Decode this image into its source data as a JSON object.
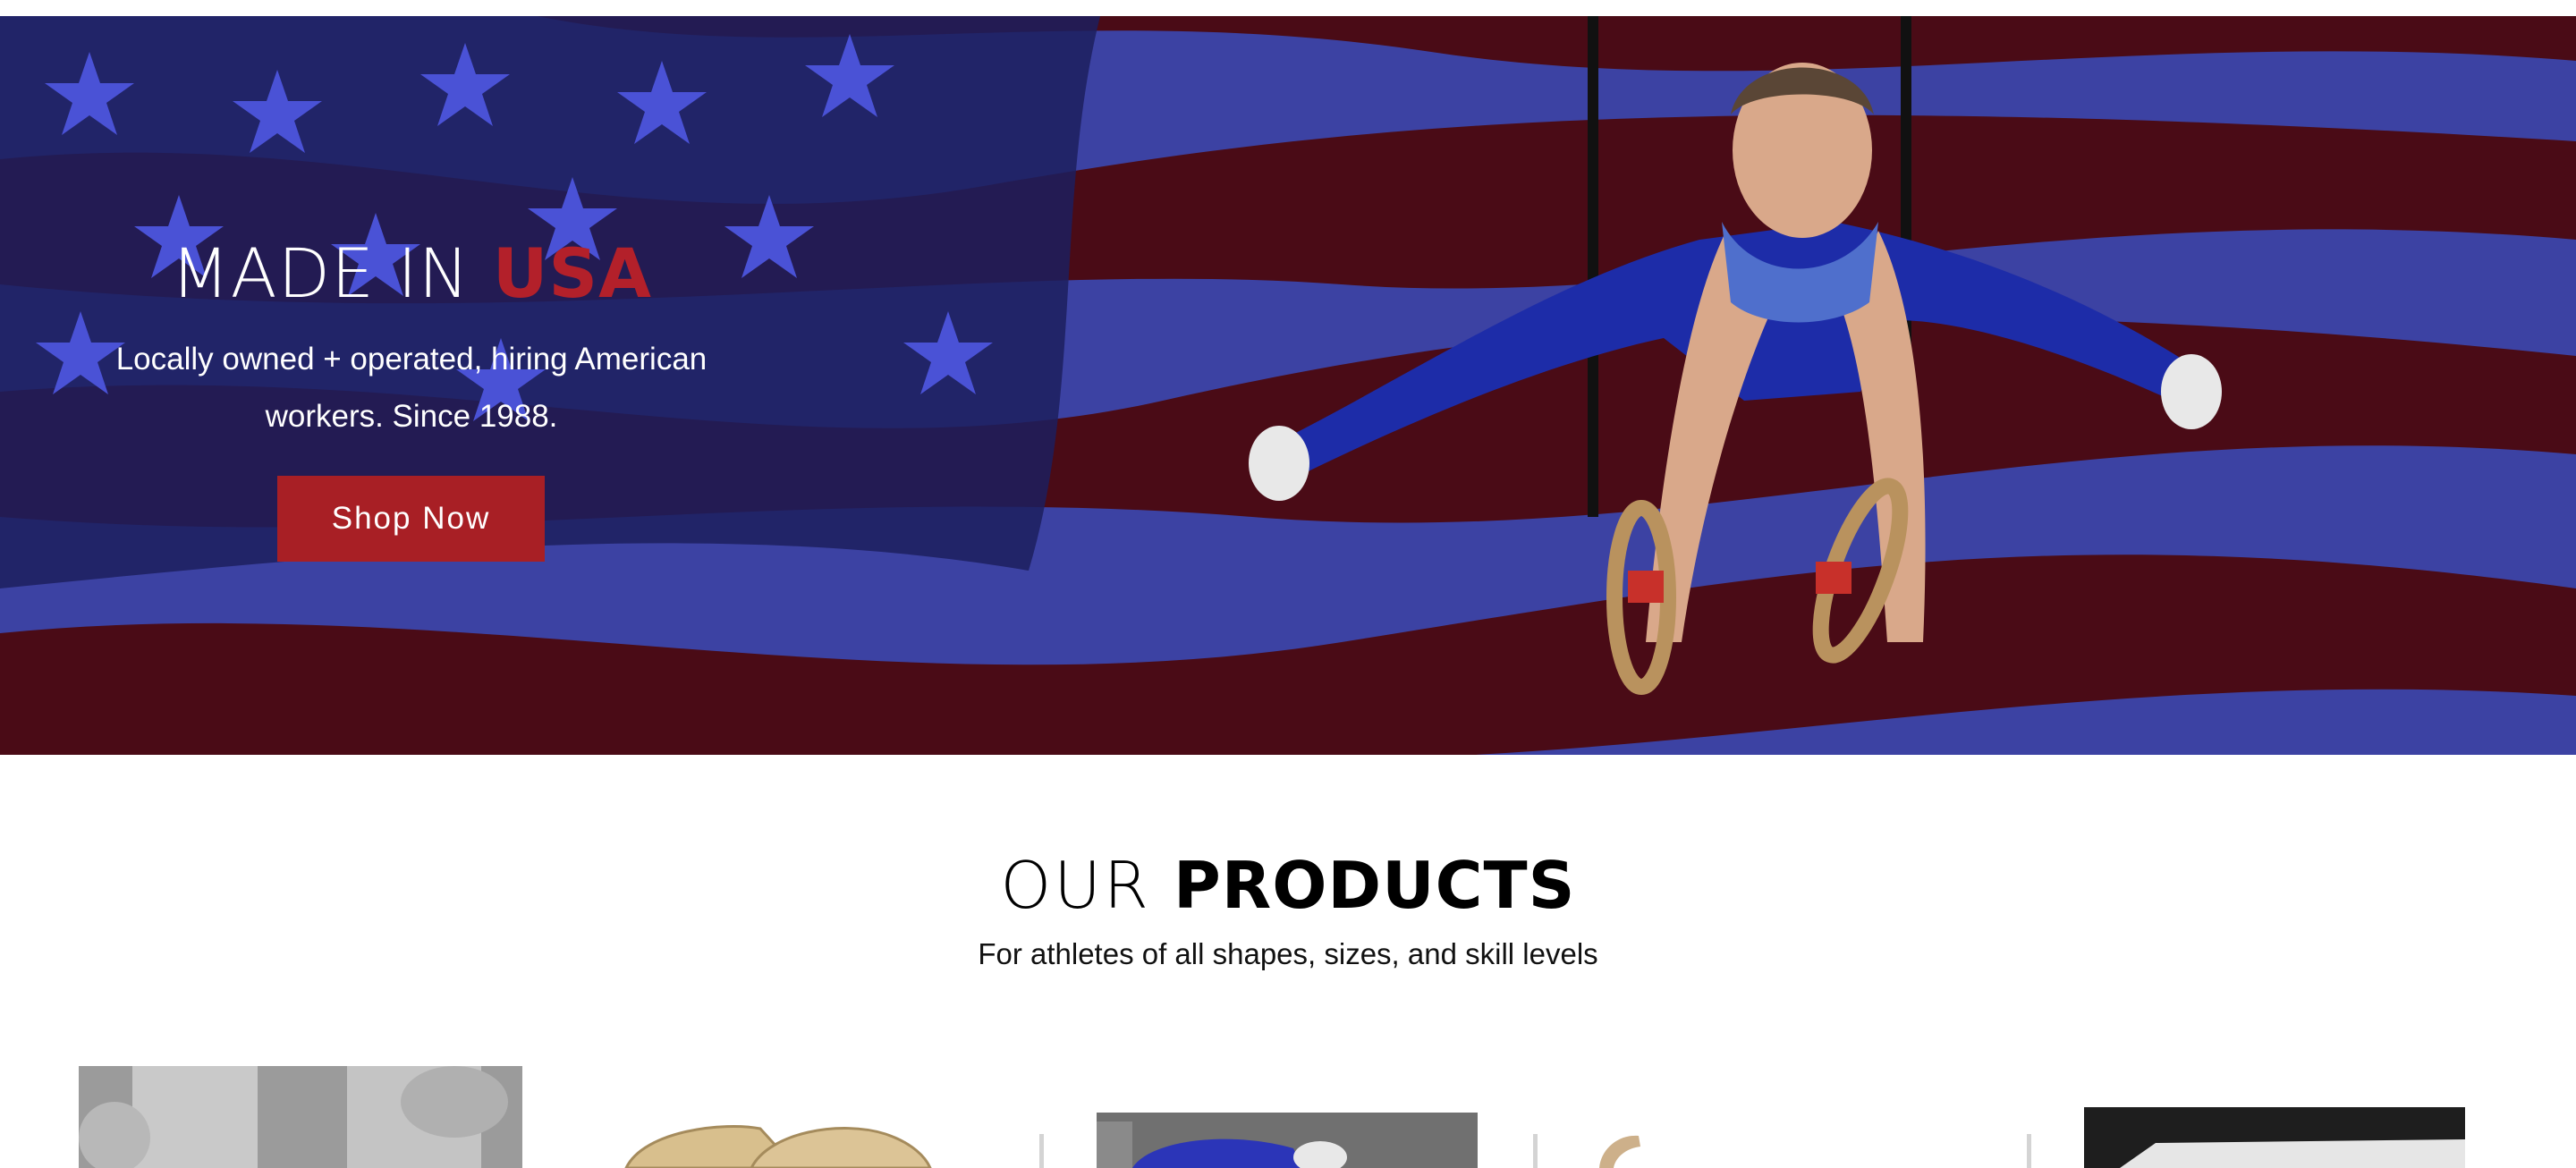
{
  "hero": {
    "title_prefix": "MADE IN",
    "title_highlight": "USA",
    "subtitle_line1": "Locally owned + operated, hiring American",
    "subtitle_line2": "workers.  Since 1988.",
    "cta_label": "Shop Now",
    "image": "gymnast-on-rings-over-american-flag"
  },
  "products_section": {
    "title_light": "OUR",
    "title_bold": "PRODUCTS",
    "subtitle": "For athletes of all shapes, sizes, and skill levels",
    "items": [
      {
        "image": "wrist-supports-photo"
      },
      {
        "image": "tan-grips-photo"
      },
      {
        "image": "blue-apparel-photo"
      },
      {
        "image": "wooden-ring-photo"
      },
      {
        "image": "mat-box-photo"
      }
    ]
  },
  "colors": {
    "accent_red": "#a81f25",
    "flag_blue": "#3d43a4",
    "flag_stripe": "#4a0a14"
  }
}
